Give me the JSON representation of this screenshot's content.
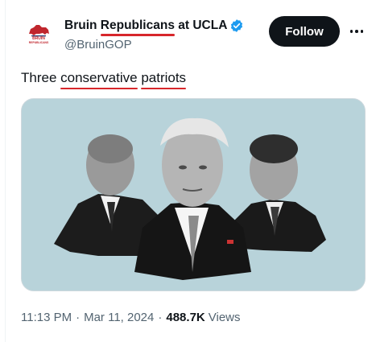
{
  "author": {
    "display_name_part1": "Bruin ",
    "display_name_part2": "Republicans",
    "display_name_part3": " at UCLA",
    "handle": "@BruinGOP",
    "avatar_text_line1": "BRUIN",
    "avatar_text_line2": "REPUBLICANS",
    "verified_icon": "verified-badge-icon"
  },
  "actions": {
    "follow_label": "Follow",
    "more_icon": "more-horizontal-icon"
  },
  "tweet": {
    "text_word1": "Three ",
    "text_word2": "conservative",
    "text_space": " ",
    "text_word3": "patriots"
  },
  "media": {
    "kind": "photo-collage-three-men"
  },
  "meta": {
    "time": "11:13 PM",
    "date": "Mar 11, 2024",
    "views_count": "488.7K",
    "views_label": "Views"
  },
  "colors": {
    "accent_black": "#0f1419",
    "secondary_text": "#536471",
    "verified_blue": "#1d9bf0",
    "spellcheck_red": "#d7262b",
    "media_bg": "#b8d3da"
  }
}
